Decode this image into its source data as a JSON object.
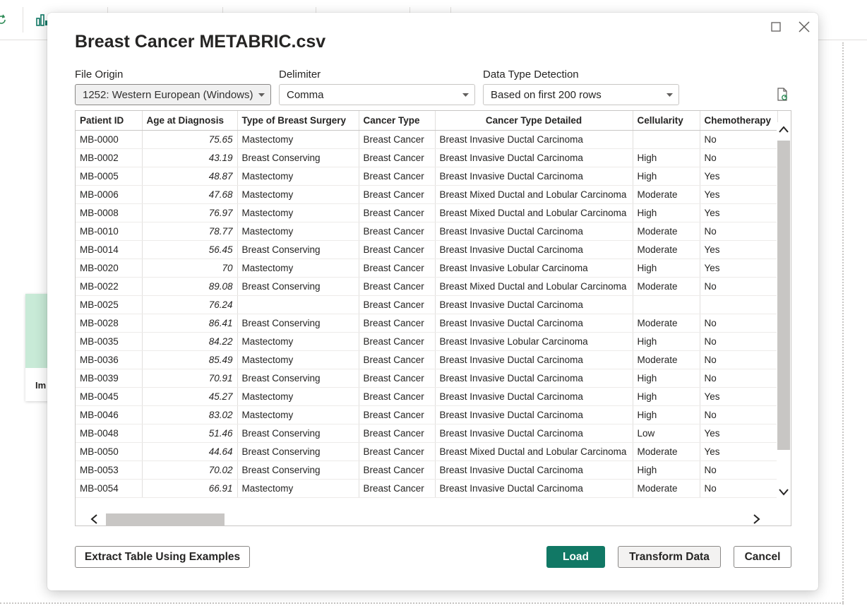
{
  "background": {
    "card_label": "Im"
  },
  "dialog": {
    "title": "Breast Cancer METABRIC.csv"
  },
  "fields": {
    "file_origin": {
      "label": "File Origin",
      "value": "1252: Western European (Windows)"
    },
    "delimiter": {
      "label": "Delimiter",
      "value": "Comma"
    },
    "data_type_detection": {
      "label": "Data Type Detection",
      "value": "Based on first 200 rows"
    }
  },
  "table": {
    "columns": [
      "Patient ID",
      "Age at Diagnosis",
      "Type of Breast Surgery",
      "Cancer Type",
      "Cancer Type Detailed",
      "Cellularity",
      "Chemotherapy"
    ],
    "rows": [
      [
        "MB-0000",
        "75.65",
        "Mastectomy",
        "Breast Cancer",
        "Breast Invasive Ductal Carcinoma",
        "",
        "No"
      ],
      [
        "MB-0002",
        "43.19",
        "Breast Conserving",
        "Breast Cancer",
        "Breast Invasive Ductal Carcinoma",
        "High",
        "No"
      ],
      [
        "MB-0005",
        "48.87",
        "Mastectomy",
        "Breast Cancer",
        "Breast Invasive Ductal Carcinoma",
        "High",
        "Yes"
      ],
      [
        "MB-0006",
        "47.68",
        "Mastectomy",
        "Breast Cancer",
        "Breast Mixed Ductal and Lobular Carcinoma",
        "Moderate",
        "Yes"
      ],
      [
        "MB-0008",
        "76.97",
        "Mastectomy",
        "Breast Cancer",
        "Breast Mixed Ductal and Lobular Carcinoma",
        "High",
        "Yes"
      ],
      [
        "MB-0010",
        "78.77",
        "Mastectomy",
        "Breast Cancer",
        "Breast Invasive Ductal Carcinoma",
        "Moderate",
        "No"
      ],
      [
        "MB-0014",
        "56.45",
        "Breast Conserving",
        "Breast Cancer",
        "Breast Invasive Ductal Carcinoma",
        "Moderate",
        "Yes"
      ],
      [
        "MB-0020",
        "70",
        "Mastectomy",
        "Breast Cancer",
        "Breast Invasive Lobular Carcinoma",
        "High",
        "Yes"
      ],
      [
        "MB-0022",
        "89.08",
        "Breast Conserving",
        "Breast Cancer",
        "Breast Mixed Ductal and Lobular Carcinoma",
        "Moderate",
        "No"
      ],
      [
        "MB-0025",
        "76.24",
        "",
        "Breast Cancer",
        "Breast Invasive Ductal Carcinoma",
        "",
        ""
      ],
      [
        "MB-0028",
        "86.41",
        "Breast Conserving",
        "Breast Cancer",
        "Breast Invasive Ductal Carcinoma",
        "Moderate",
        "No"
      ],
      [
        "MB-0035",
        "84.22",
        "Mastectomy",
        "Breast Cancer",
        "Breast Invasive Lobular Carcinoma",
        "High",
        "No"
      ],
      [
        "MB-0036",
        "85.49",
        "Mastectomy",
        "Breast Cancer",
        "Breast Invasive Ductal Carcinoma",
        "Moderate",
        "No"
      ],
      [
        "MB-0039",
        "70.91",
        "Breast Conserving",
        "Breast Cancer",
        "Breast Invasive Ductal Carcinoma",
        "High",
        "No"
      ],
      [
        "MB-0045",
        "45.27",
        "Mastectomy",
        "Breast Cancer",
        "Breast Invasive Ductal Carcinoma",
        "High",
        "Yes"
      ],
      [
        "MB-0046",
        "83.02",
        "Mastectomy",
        "Breast Cancer",
        "Breast Invasive Ductal Carcinoma",
        "High",
        "No"
      ],
      [
        "MB-0048",
        "51.46",
        "Breast Conserving",
        "Breast Cancer",
        "Breast Invasive Ductal Carcinoma",
        "Low",
        "Yes"
      ],
      [
        "MB-0050",
        "44.64",
        "Breast Conserving",
        "Breast Cancer",
        "Breast Mixed Ductal and Lobular Carcinoma",
        "Moderate",
        "Yes"
      ],
      [
        "MB-0053",
        "70.02",
        "Breast Conserving",
        "Breast Cancer",
        "Breast Invasive Ductal Carcinoma",
        "High",
        "No"
      ],
      [
        "MB-0054",
        "66.91",
        "Mastectomy",
        "Breast Cancer",
        "Breast Invasive Ductal Carcinoma",
        "Moderate",
        "No"
      ]
    ]
  },
  "buttons": {
    "extract": "Extract Table Using Examples",
    "load": "Load",
    "transform": "Transform Data",
    "cancel": "Cancel"
  },
  "icons": {
    "window_maximize": "maximize-icon",
    "window_close": "close-icon",
    "refresh_preview": "refresh-document-icon",
    "dropdown": "chevron-down-icon"
  },
  "colors": {
    "primary_button": "#117865",
    "accent_green": "#2e8b57",
    "scroll_thumb": "#c8c6c4"
  }
}
